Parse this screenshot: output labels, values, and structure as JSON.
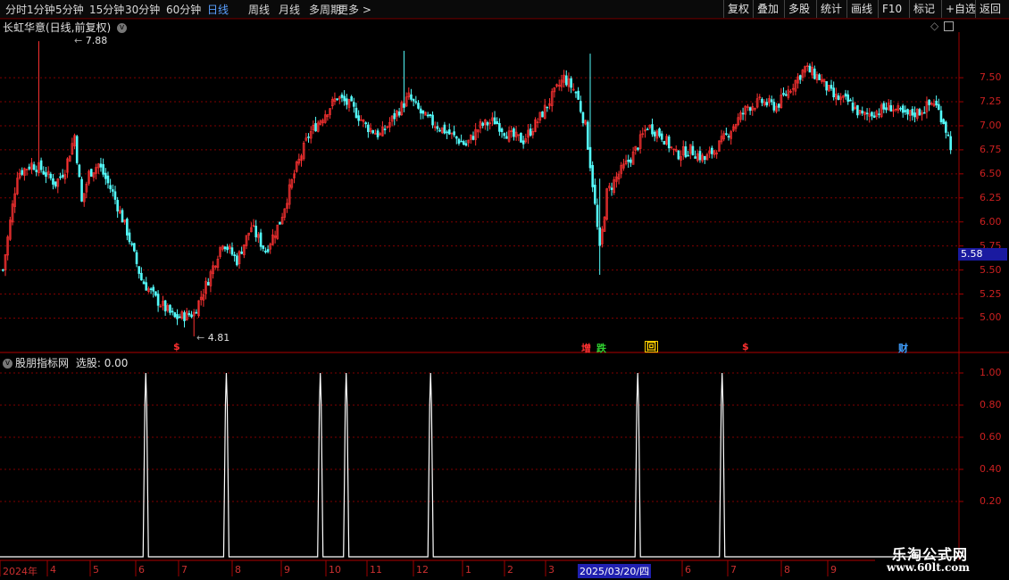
{
  "toolbar": {
    "periods": [
      "分时",
      "1分钟",
      "5分钟",
      "15分钟",
      "30分钟",
      "60分钟",
      "日线",
      "周线",
      "月线",
      "多周期",
      "更多"
    ],
    "active_period": "日线",
    "right_buttons": [
      "复权",
      "叠加",
      "多股",
      "统计",
      "画线",
      "F10",
      "标记",
      "+自选",
      "返回"
    ]
  },
  "main_chart": {
    "title": "长虹华意(日线,前复权)",
    "high_label": "7.88",
    "low_label": "4.81",
    "current_price": "5.58",
    "y_ticks": [
      "7.50",
      "7.25",
      "7.00",
      "6.75",
      "6.50",
      "6.25",
      "6.00",
      "5.75",
      "5.50",
      "5.25",
      "5.00"
    ],
    "markers": [
      {
        "text": "$",
        "color": "#ff3030"
      },
      {
        "text": "增",
        "color": "#ff3030"
      },
      {
        "text": "跌",
        "color": "#30d030"
      },
      {
        "text": "回",
        "color": "#ffd000"
      },
      {
        "text": "$",
        "color": "#ff3030"
      },
      {
        "text": "财",
        "color": "#40a0ff"
      }
    ]
  },
  "indicator": {
    "title": "股朋指标网",
    "signal_label": "选股: 0.00",
    "y_ticks": [
      "1.00",
      "0.80",
      "0.60",
      "0.40",
      "0.20"
    ]
  },
  "x_axis": {
    "labels": [
      "2024年",
      "4",
      "5",
      "6",
      "7",
      "8",
      "9",
      "10",
      "11",
      "12",
      "1",
      "2",
      "3",
      "2025/03/20/四",
      "6",
      "7",
      "8",
      "9"
    ]
  },
  "watermark": {
    "line1": "乐淘公式网",
    "line2": "www.60lt.com"
  },
  "colors": {
    "up": "#ff3232",
    "down": "#54fcfc",
    "grid": "#800000",
    "axis": "#a00000",
    "signal": "#ffffff"
  },
  "chart_data": [
    {
      "type": "candlestick",
      "title": "长虹华意(日线,前复权)",
      "ylim": [
        4.8,
        7.9
      ],
      "y_ticks": [
        5.0,
        5.25,
        5.5,
        5.75,
        6.0,
        6.25,
        6.5,
        6.75,
        7.0,
        7.25,
        7.5
      ],
      "period": "2024年 - 2025年9月 (日线)",
      "max": 7.88,
      "min": 4.81,
      "last_marked": 5.58,
      "close_trend": [
        {
          "i": 0,
          "c": 5.5
        },
        {
          "i": 6,
          "c": 6.5
        },
        {
          "i": 12,
          "c": 6.6
        },
        {
          "i": 16,
          "c": 6.55
        },
        {
          "i": 22,
          "c": 6.4
        },
        {
          "i": 26,
          "c": 6.55
        },
        {
          "i": 30,
          "c": 6.9
        },
        {
          "i": 33,
          "c": 6.2
        },
        {
          "i": 36,
          "c": 6.5
        },
        {
          "i": 40,
          "c": 6.6
        },
        {
          "i": 46,
          "c": 6.3
        },
        {
          "i": 52,
          "c": 5.9
        },
        {
          "i": 58,
          "c": 5.4
        },
        {
          "i": 64,
          "c": 5.2
        },
        {
          "i": 72,
          "c": 5.0
        },
        {
          "i": 80,
          "c": 5.05
        },
        {
          "i": 86,
          "c": 5.4
        },
        {
          "i": 92,
          "c": 5.8
        },
        {
          "i": 98,
          "c": 5.6
        },
        {
          "i": 104,
          "c": 5.95
        },
        {
          "i": 110,
          "c": 5.7
        },
        {
          "i": 116,
          "c": 6.0
        },
        {
          "i": 122,
          "c": 6.5
        },
        {
          "i": 128,
          "c": 6.9
        },
        {
          "i": 134,
          "c": 7.1
        },
        {
          "i": 140,
          "c": 7.3
        },
        {
          "i": 146,
          "c": 7.2
        },
        {
          "i": 152,
          "c": 7.0
        },
        {
          "i": 158,
          "c": 6.9
        },
        {
          "i": 164,
          "c": 7.1
        },
        {
          "i": 170,
          "c": 7.3
        },
        {
          "i": 176,
          "c": 7.1
        },
        {
          "i": 182,
          "c": 7.0
        },
        {
          "i": 188,
          "c": 6.9
        },
        {
          "i": 194,
          "c": 6.8
        },
        {
          "i": 200,
          "c": 7.0
        },
        {
          "i": 206,
          "c": 7.05
        },
        {
          "i": 212,
          "c": 6.9
        },
        {
          "i": 218,
          "c": 6.85
        },
        {
          "i": 224,
          "c": 7.05
        },
        {
          "i": 230,
          "c": 7.3
        },
        {
          "i": 235,
          "c": 7.5
        },
        {
          "i": 240,
          "c": 7.35
        },
        {
          "i": 244,
          "c": 7.0
        },
        {
          "i": 247,
          "c": 6.4
        },
        {
          "i": 250,
          "c": 5.7
        },
        {
          "i": 253,
          "c": 6.3
        },
        {
          "i": 258,
          "c": 6.5
        },
        {
          "i": 264,
          "c": 6.7
        },
        {
          "i": 270,
          "c": 7.0
        },
        {
          "i": 276,
          "c": 6.9
        },
        {
          "i": 282,
          "c": 6.7
        },
        {
          "i": 288,
          "c": 6.75
        },
        {
          "i": 294,
          "c": 6.65
        },
        {
          "i": 300,
          "c": 6.8
        },
        {
          "i": 306,
          "c": 7.0
        },
        {
          "i": 312,
          "c": 7.2
        },
        {
          "i": 318,
          "c": 7.25
        },
        {
          "i": 324,
          "c": 7.2
        },
        {
          "i": 330,
          "c": 7.4
        },
        {
          "i": 336,
          "c": 7.6
        },
        {
          "i": 342,
          "c": 7.5
        },
        {
          "i": 348,
          "c": 7.3
        },
        {
          "i": 354,
          "c": 7.25
        },
        {
          "i": 360,
          "c": 7.1
        },
        {
          "i": 366,
          "c": 7.15
        },
        {
          "i": 372,
          "c": 7.2
        },
        {
          "i": 378,
          "c": 7.1
        },
        {
          "i": 384,
          "c": 7.15
        },
        {
          "i": 390,
          "c": 7.25
        },
        {
          "i": 394,
          "c": 7.05
        },
        {
          "i": 397,
          "c": 6.8
        }
      ]
    },
    {
      "type": "line",
      "title": "股朋指标网",
      "series": [
        {
          "name": "选股",
          "spikes_at_x_fraction": [
            0.152,
            0.236,
            0.334,
            0.361,
            0.449,
            0.665,
            0.753
          ],
          "spike_value": 1.0,
          "base_value": 0.0
        }
      ],
      "ylim": [
        0,
        1.05
      ],
      "y_ticks": [
        0.2,
        0.4,
        0.6,
        0.8,
        1.0
      ]
    }
  ]
}
